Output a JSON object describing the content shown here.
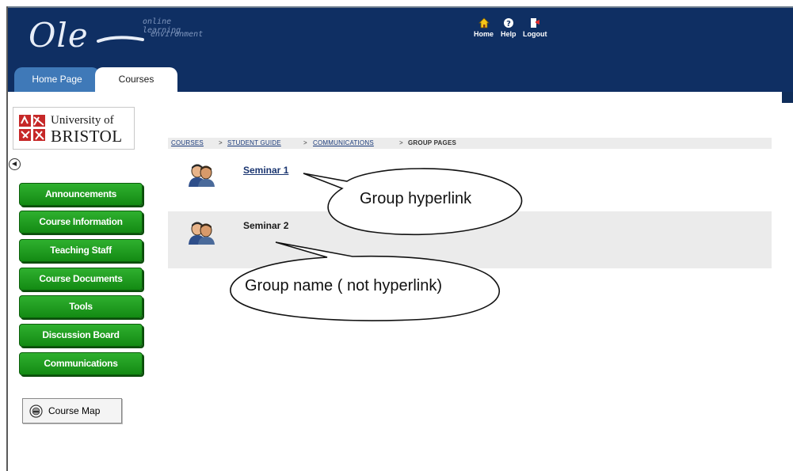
{
  "header": {
    "logo_word": "Ole",
    "logo_tagline_1": "online learning",
    "logo_tagline_2": "environment",
    "top_links": [
      {
        "label": "Home",
        "icon": "home-icon"
      },
      {
        "label": "Help",
        "icon": "help-icon"
      },
      {
        "label": "Logout",
        "icon": "logout-icon"
      }
    ],
    "background_color": "#0f2f63"
  },
  "tabs": [
    {
      "label": "Home Page",
      "active": false
    },
    {
      "label": "Courses",
      "active": true
    }
  ],
  "sidebar": {
    "institution_line1": "University of",
    "institution_line2": "BRISTOL",
    "nav_items": [
      {
        "label": "Announcements"
      },
      {
        "label": "Course Information"
      },
      {
        "label": "Teaching Staff"
      },
      {
        "label": "Course Documents"
      },
      {
        "label": "Tools"
      },
      {
        "label": "Discussion Board"
      },
      {
        "label": "Communications"
      }
    ],
    "course_map_label": "Course Map",
    "nav_color": "#1a9a1a"
  },
  "breadcrumb": {
    "items": [
      "COURSES",
      "STUDENT GUIDE",
      "COMMUNICATIONS"
    ],
    "current": "GROUP PAGES",
    "separator": ">"
  },
  "groups": [
    {
      "name": "Seminar 1",
      "is_link": true
    },
    {
      "name": "Seminar 2",
      "is_link": false
    }
  ],
  "callouts": [
    {
      "text": "Group hyperlink"
    },
    {
      "text": "Group name ( not hyperlink)"
    }
  ]
}
